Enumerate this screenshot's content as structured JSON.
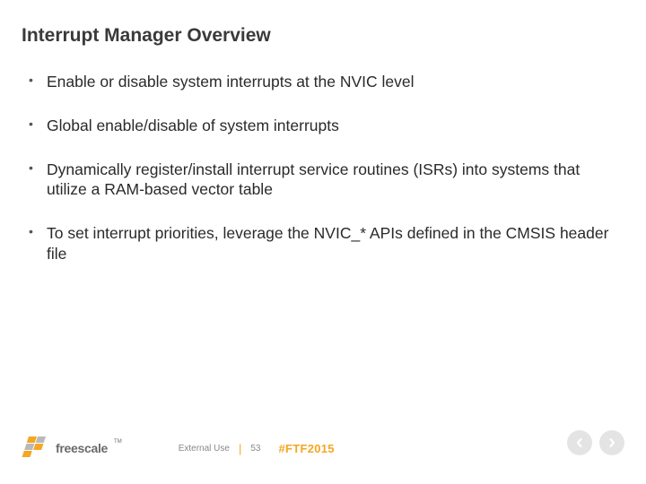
{
  "title": "Interrupt Manager Overview",
  "bullets": [
    "Enable or disable system interrupts at the NVIC level",
    "Global enable/disable of system interrupts",
    "Dynamically register/install interrupt service routines (ISRs) into systems that utilize a RAM-based vector table",
    "To set interrupt priorities, leverage the NVIC_* APIs defined in the CMSIS header file"
  ],
  "footer": {
    "brand": "freescale",
    "tm": "TM",
    "external": "External Use",
    "page": "53",
    "hashtag": "#FTF2015"
  }
}
